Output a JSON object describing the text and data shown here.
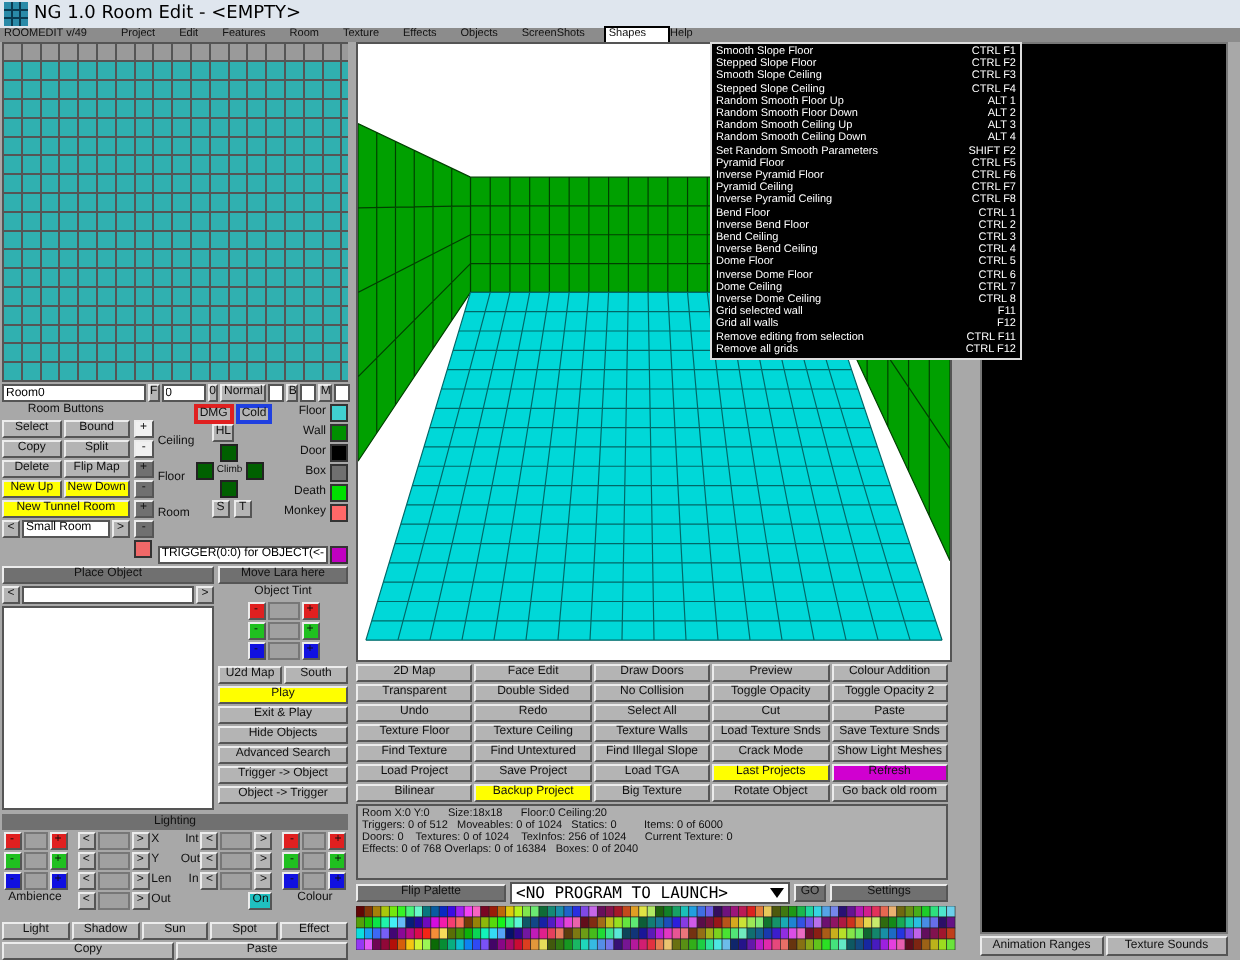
{
  "window": {
    "title": "NG 1.0 Room Edit - <EMPTY>"
  },
  "menu": [
    {
      "label": "ROOMEDIT v/49",
      "selected": false
    },
    {
      "label": "Project",
      "selected": false
    },
    {
      "label": "Edit",
      "selected": false
    },
    {
      "label": "Features",
      "selected": false
    },
    {
      "label": "Room",
      "selected": false
    },
    {
      "label": "Texture",
      "selected": false
    },
    {
      "label": "Effects",
      "selected": false
    },
    {
      "label": "Objects",
      "selected": false
    },
    {
      "label": "ScreenShots",
      "selected": false
    },
    {
      "label": "Shapes",
      "selected": true
    },
    {
      "label": "Help",
      "selected": false
    }
  ],
  "shapes_menu": [
    {
      "label": "Smooth Slope Floor",
      "shortcut": "CTRL F1"
    },
    {
      "label": "Stepped Slope Floor",
      "shortcut": "CTRL F2"
    },
    {
      "label": "Smooth Slope Ceiling",
      "shortcut": "CTRL F3"
    },
    {
      "label": "Stepped Slope Ceiling",
      "shortcut": "CTRL F4"
    },
    {
      "label": "Random Smooth Floor Up",
      "shortcut": "ALT 1"
    },
    {
      "label": "Random Smooth Floor Down",
      "shortcut": "ALT 2"
    },
    {
      "label": "Random Smooth Ceiling Up",
      "shortcut": "ALT 3"
    },
    {
      "label": "Random Smooth Ceiling Down",
      "shortcut": "ALT 4"
    },
    {
      "label": "Set Random Smooth Parameters",
      "shortcut": "SHIFT F2"
    },
    {
      "label": "Pyramid Floor",
      "shortcut": "CTRL F5"
    },
    {
      "label": "Inverse Pyramid Floor",
      "shortcut": "CTRL F6"
    },
    {
      "label": "Pyramid Ceiling",
      "shortcut": "CTRL F7"
    },
    {
      "label": "Inverse Pyramid Ceiling",
      "shortcut": "CTRL F8"
    },
    {
      "label": "Bend Floor",
      "shortcut": "CTRL 1"
    },
    {
      "label": "Inverse Bend Floor",
      "shortcut": "CTRL 2"
    },
    {
      "label": "Bend Ceiling",
      "shortcut": "CTRL 3"
    },
    {
      "label": "Inverse Bend Ceiling",
      "shortcut": "CTRL 4"
    },
    {
      "label": "Dome Floor",
      "shortcut": "CTRL 5"
    },
    {
      "label": "Inverse Dome Floor",
      "shortcut": "CTRL 6"
    },
    {
      "label": "Dome Ceiling",
      "shortcut": "CTRL 7"
    },
    {
      "label": "Inverse Dome Ceiling",
      "shortcut": "CTRL 8"
    },
    {
      "label": "Grid selected wall",
      "shortcut": "F11"
    },
    {
      "label": "Grid all walls",
      "shortcut": "F12"
    },
    {
      "label": "Remove editing from selection",
      "shortcut": "CTRL F11"
    },
    {
      "label": "Remove all grids",
      "shortcut": "CTRL F12"
    }
  ],
  "room_bar": {
    "name": "Room0",
    "f_button": "F",
    "f_value": "0",
    "o_button": "0",
    "mode": "Normal",
    "b_button": "B",
    "m_button": "M"
  },
  "room_buttons": {
    "title": "Room Buttons",
    "buttons": [
      {
        "label": "Select",
        "color": "#b4b4b4"
      },
      {
        "label": "Bound",
        "color": "#b4b4b4"
      },
      {
        "label": "Copy",
        "color": "#b4b4b4"
      },
      {
        "label": "Split",
        "color": "#b4b4b4"
      },
      {
        "label": "Delete",
        "color": "#b4b4b4"
      },
      {
        "label": "Flip Map",
        "color": "#b4b4b4"
      },
      {
        "label": "New Up",
        "color": "#ffff00"
      },
      {
        "label": "New Down",
        "color": "#ffff00"
      },
      {
        "label": "New Tunnel Room",
        "color": "#ffff00"
      }
    ],
    "size": {
      "prev": "<",
      "value": "Small Room",
      "next": ">"
    }
  },
  "height_controls": [
    {
      "label": "Ceiling",
      "plus": "+",
      "minus": "-"
    },
    {
      "label": "Floor",
      "plus": "+",
      "minus": "-"
    },
    {
      "label": "Room",
      "plus": "+",
      "minus": "-"
    }
  ],
  "flags": [
    {
      "label": "DMG",
      "color": "#e02020"
    },
    {
      "label": "Cold",
      "color": "#2040e0"
    }
  ],
  "hl_button": "HL",
  "climb": "Climb",
  "climb_toggles": [
    {
      "checked": false
    },
    {
      "checked": false
    },
    {
      "checked": false
    },
    {
      "checked": false
    }
  ],
  "s_button": "S",
  "t_button": "T",
  "sector_types": [
    {
      "label": "Floor",
      "color": "#40d0d0"
    },
    {
      "label": "Wall",
      "color": "#009000"
    },
    {
      "label": "Door",
      "color": "#000000"
    },
    {
      "label": "Box",
      "color": "#707070"
    },
    {
      "label": "Death",
      "color": "#00e000"
    },
    {
      "label": "Monkey",
      "color": "#ff6868"
    }
  ],
  "trigger": {
    "text": "TRIGGER(0:0) for OBJECT(<-",
    "color": "#c000c0"
  },
  "object_panel": {
    "place_button": "Place Object",
    "move_button": "Move Lara here",
    "prev": "<",
    "next": ">",
    "tint_title": "Object Tint",
    "tint": [
      {
        "minus": "-",
        "plus": "+",
        "color": "#e02020"
      },
      {
        "minus": "-",
        "plus": "+",
        "color": "#20c020"
      },
      {
        "minus": "-",
        "plus": "+",
        "color": "#1010e0"
      }
    ],
    "map_buttons": [
      "U2d Map",
      "South"
    ],
    "buttons": [
      {
        "label": "Play",
        "color": "#ffff00"
      },
      {
        "label": "Exit & Play",
        "color": "#b4b4b4"
      },
      {
        "label": "Hide Objects",
        "color": "#b4b4b4"
      },
      {
        "label": "Advanced Search",
        "color": "#b4b4b4"
      },
      {
        "label": "Trigger -> Object",
        "color": "#b4b4b4"
      },
      {
        "label": "Object -> Trigger",
        "color": "#b4b4b4"
      }
    ]
  },
  "lighting": {
    "title": "Lighting",
    "ambience": {
      "label": "Ambience",
      "rows": [
        {
          "minus": "-",
          "plus": "+",
          "color": "#e02020"
        },
        {
          "minus": "-",
          "plus": "+",
          "color": "#20c020"
        },
        {
          "minus": "-",
          "plus": "+",
          "color": "#1010e0"
        }
      ]
    },
    "sliders": [
      {
        "prev": "<",
        "next": ">",
        "label": "X"
      },
      {
        "prev": "<",
        "next": ">",
        "label": "Y"
      },
      {
        "prev": "<",
        "next": ">",
        "label": "Len"
      },
      {
        "prev": "<",
        "next": ">",
        "label": "Out"
      }
    ],
    "sliders2": [
      {
        "prev": "<",
        "next": ">",
        "label": "Int"
      },
      {
        "prev": "<",
        "next": ">",
        "label": "Out"
      },
      {
        "prev": "<",
        "next": ">",
        "label": "In"
      }
    ],
    "on_button": {
      "label": "On",
      "on": true
    },
    "colour": {
      "label": "Colour",
      "rows": [
        {
          "minus": "-",
          "plus": "+",
          "color": "#e02020"
        },
        {
          "minus": "-",
          "plus": "+",
          "color": "#20c020"
        },
        {
          "minus": "-",
          "plus": "+",
          "color": "#1010e0"
        }
      ]
    },
    "types": [
      "Light",
      "Shadow",
      "Sun",
      "Spot",
      "Effect"
    ],
    "copy": "Copy",
    "paste": "Paste"
  },
  "tools": [
    {
      "label": "2D Map",
      "color": "#b4b4b4"
    },
    {
      "label": "Face Edit",
      "color": "#b4b4b4"
    },
    {
      "label": "Draw Doors",
      "color": "#b4b4b4"
    },
    {
      "label": "Preview",
      "color": "#b4b4b4"
    },
    {
      "label": "Colour Addition",
      "color": "#b4b4b4"
    },
    {
      "label": "Transparent",
      "color": "#b4b4b4"
    },
    {
      "label": "Double Sided",
      "color": "#b4b4b4"
    },
    {
      "label": "No Collision",
      "color": "#b4b4b4"
    },
    {
      "label": "Toggle Opacity",
      "color": "#b4b4b4"
    },
    {
      "label": "Toggle Opacity 2",
      "color": "#b4b4b4"
    },
    {
      "label": "Undo",
      "color": "#b4b4b4"
    },
    {
      "label": "Redo",
      "color": "#b4b4b4"
    },
    {
      "label": "Select All",
      "color": "#b4b4b4"
    },
    {
      "label": "Cut",
      "color": "#b4b4b4"
    },
    {
      "label": "Paste",
      "color": "#b4b4b4"
    },
    {
      "label": "Texture Floor",
      "color": "#b4b4b4"
    },
    {
      "label": "Texture Ceiling",
      "color": "#b4b4b4"
    },
    {
      "label": "Texture Walls",
      "color": "#b4b4b4"
    },
    {
      "label": "Load Texture Snds",
      "color": "#b4b4b4"
    },
    {
      "label": "Save Texture Snds",
      "color": "#b4b4b4"
    },
    {
      "label": "Find Texture",
      "color": "#b4b4b4"
    },
    {
      "label": "Find Untextured",
      "color": "#b4b4b4"
    },
    {
      "label": "Find Illegal Slope",
      "color": "#b4b4b4"
    },
    {
      "label": "Crack Mode",
      "color": "#b4b4b4"
    },
    {
      "label": "Show Light Meshes",
      "color": "#b4b4b4"
    },
    {
      "label": "Load Project",
      "color": "#b4b4b4"
    },
    {
      "label": "Save Project",
      "color": "#b4b4b4"
    },
    {
      "label": "Load TGA",
      "color": "#b4b4b4"
    },
    {
      "label": "Last Projects",
      "color": "#ffff00"
    },
    {
      "label": "Refresh",
      "color": "#d000d0"
    },
    {
      "label": "Bilinear",
      "color": "#b4b4b4"
    },
    {
      "label": "Backup Project",
      "color": "#ffff00"
    },
    {
      "label": "Big Texture",
      "color": "#b4b4b4"
    },
    {
      "label": "Rotate Object",
      "color": "#b4b4b4"
    },
    {
      "label": "Go back old room",
      "color": "#b4b4b4"
    }
  ],
  "info_lines": [
    "Room X:0 Y:0      Size:18x18      Floor:0 Ceiling:20",
    "Triggers: 0 of 512   Moveables: 0 of 1024   Statics: 0         Items: 0 of 6000",
    "Doors: 0    Textures: 0 of 1024    TexInfos: 256 of 1024      Current Texture: 0",
    "Effects: 0 of 768 Overlaps: 0 of 16384   Boxes: 0 of 2040"
  ],
  "launcher": {
    "flip_button": "Flip Palette",
    "program": "<NO PROGRAM TO LAUNCH>",
    "go_button": "GO",
    "settings_button": "Settings"
  },
  "right_tabs": [
    "Animation Ranges",
    "Texture Sounds"
  ]
}
